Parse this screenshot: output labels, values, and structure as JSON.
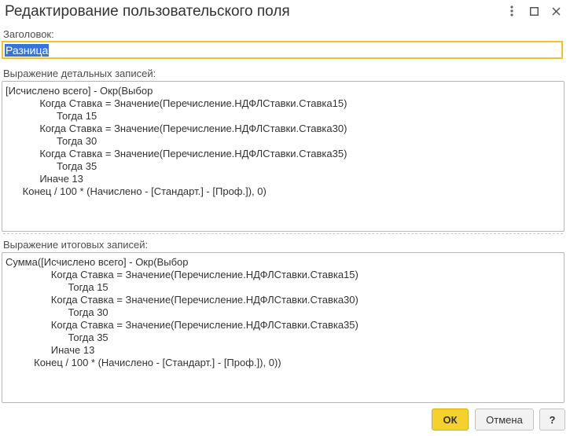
{
  "dialog": {
    "title": "Редактирование пользовательского поля"
  },
  "title_field": {
    "label": "Заголовок:",
    "value": "Разница"
  },
  "detail_expr": {
    "label": "Выражение детальных записей:",
    "lines": [
      "[Исчислено всего] - Окр(Выбор",
      "            Когда Ставка = Значение(Перечисление.НДФЛСтавки.Ставка15)",
      "                  Тогда 15",
      "            Когда Ставка = Значение(Перечисление.НДФЛСтавки.Ставка30)",
      "                  Тогда 30",
      "            Когда Ставка = Значение(Перечисление.НДФЛСтавки.Ставка35)",
      "                  Тогда 35",
      "            Иначе 13",
      "      Конец / 100 * (Начислено - [Стандарт.] - [Проф.]), 0)"
    ]
  },
  "total_expr": {
    "label": "Выражение итоговых записей:",
    "lines": [
      "Сумма([Исчислено всего] - Окр(Выбор",
      "                Когда Ставка = Значение(Перечисление.НДФЛСтавки.Ставка15)",
      "                      Тогда 15",
      "                Когда Ставка = Значение(Перечисление.НДФЛСтавки.Ставка30)",
      "                      Тогда 30",
      "                Когда Ставка = Значение(Перечисление.НДФЛСтавки.Ставка35)",
      "                      Тогда 35",
      "                Иначе 13",
      "          Конец / 100 * (Начислено - [Стандарт.] - [Проф.]), 0))"
    ]
  },
  "buttons": {
    "ok": "ОК",
    "cancel": "Отмена",
    "help": "?"
  },
  "icons": {
    "more": "more-vertical-icon",
    "maximize": "maximize-icon",
    "close": "close-icon"
  },
  "colors": {
    "accent": "#f5d12e",
    "focus_border": "#f2c22b",
    "selection": "#3874d8"
  }
}
